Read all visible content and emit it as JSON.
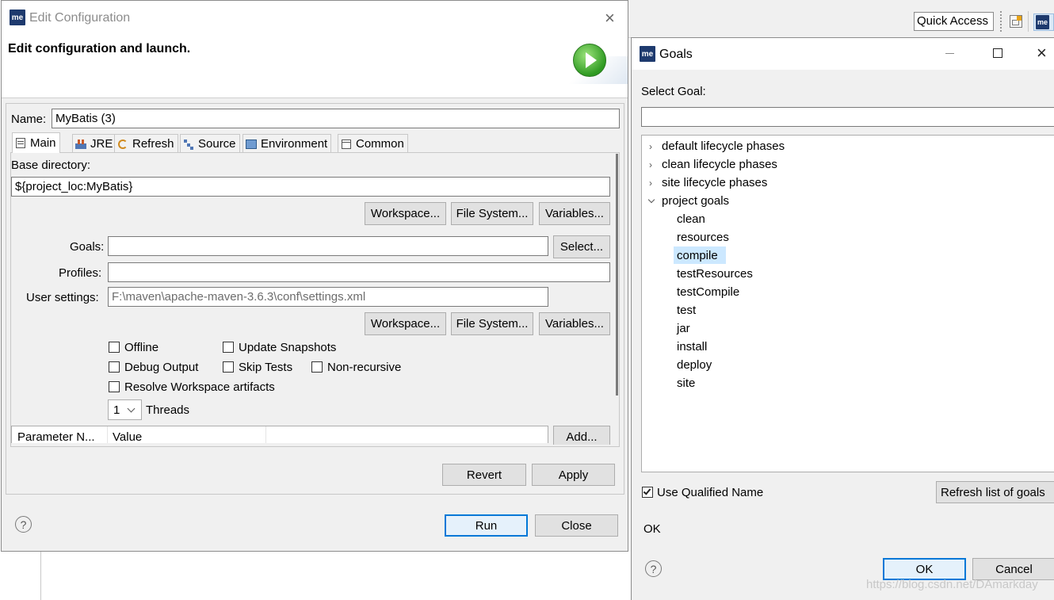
{
  "topbar": {
    "quick_access": "Quick Access"
  },
  "edit_dialog": {
    "title": "Edit Configuration",
    "logo": "me",
    "heading": "Edit configuration and launch.",
    "name_label": "Name:",
    "name_value": "MyBatis (3)",
    "tabs": [
      {
        "label": "Main",
        "icon": "main-tab-icon"
      },
      {
        "label": "JRE",
        "icon": "jre-icon"
      },
      {
        "label": "Refresh",
        "icon": "refresh-icon"
      },
      {
        "label": "Source",
        "icon": "source-icon"
      },
      {
        "label": "Environment",
        "icon": "environment-icon"
      },
      {
        "label": "Common",
        "icon": "common-icon"
      }
    ],
    "base_dir_label": "Base directory:",
    "base_dir_value": "${project_loc:MyBatis}",
    "workspace_btn": "Workspace...",
    "filesystem_btn": "File System...",
    "variables_btn": "Variables...",
    "goals_label": "Goals:",
    "goals_value": "",
    "select_btn": "Select...",
    "profiles_label": "Profiles:",
    "profiles_value": "",
    "user_settings_label": "User settings:",
    "user_settings_value": "F:\\maven\\apache-maven-3.6.3\\conf\\settings.xml",
    "offline": "Offline",
    "update_snapshots": "Update Snapshots",
    "debug_output": "Debug Output",
    "skip_tests": "Skip Tests",
    "non_recursive": "Non-recursive",
    "resolve_workspace": "Resolve Workspace artifacts",
    "threads_value": "1",
    "threads_label": "Threads",
    "param_col_name": "Parameter N...",
    "param_col_value": "Value",
    "add_btn": "Add...",
    "revert_btn": "Revert",
    "apply_btn": "Apply",
    "run_btn": "Run",
    "close_btn": "Close",
    "help": "?"
  },
  "goals_dialog": {
    "title": "Goals",
    "logo": "me",
    "select_goal_label": "Select Goal:",
    "filter_value": "",
    "tree": [
      {
        "label": "default lifecycle phases",
        "expanded": false
      },
      {
        "label": "clean lifecycle phases",
        "expanded": false
      },
      {
        "label": "site lifecycle phases",
        "expanded": false
      },
      {
        "label": "project goals",
        "expanded": true
      }
    ],
    "goals": [
      "clean",
      "resources",
      "compile",
      "testResources",
      "testCompile",
      "test",
      "jar",
      "install",
      "deploy",
      "site"
    ],
    "selected_goal": "compile",
    "use_qualified_name": "Use Qualified Name",
    "refresh_btn": "Refresh list of goals",
    "status": "OK",
    "ok_btn": "OK",
    "cancel_btn": "Cancel",
    "help": "?",
    "watermark": "https://blog.csdn.net/DAmarkday"
  },
  "colors": {
    "accent": "#0078d7",
    "selection": "#cce8ff",
    "logo": "#1e3a6e"
  }
}
